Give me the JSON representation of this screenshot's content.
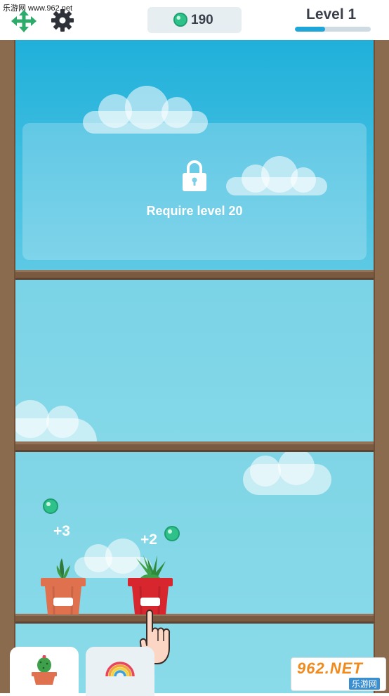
{
  "watermark": "乐游网 www.962.net",
  "header": {
    "gem_count": "190",
    "level_label": "Level 1",
    "level_progress": 0.4
  },
  "shelves": {
    "locked_text": "Require level 20"
  },
  "plants": [
    {
      "plus_label": "+3",
      "pot_color": "#e0714e"
    },
    {
      "plus_label": "+2",
      "pot_color": "#d8262f"
    }
  ],
  "tabs": [
    {
      "icon": "cactus-icon",
      "selected": true
    },
    {
      "icon": "rainbow-icon",
      "selected": false
    }
  ],
  "badge": {
    "main": "962.NET",
    "sub": "乐游网"
  },
  "colors": {
    "accent": "#1ea6d9",
    "gem": "#2ec28a",
    "wood": "#7a5b41"
  }
}
